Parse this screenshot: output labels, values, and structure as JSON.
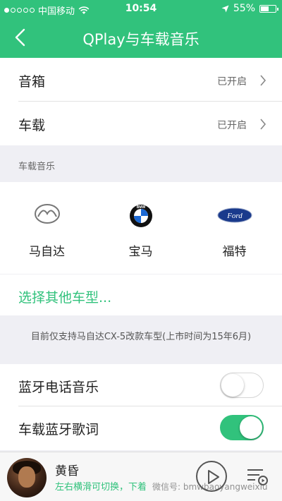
{
  "status_bar": {
    "carrier": "中国移动",
    "time": "10:54",
    "battery": "55%",
    "battery_level": 0.55,
    "signal_bars_filled": 1,
    "signal_bars_total": 5
  },
  "nav": {
    "title": "QPlay与车载音乐",
    "back_icon": "chevron-left-icon"
  },
  "settings": [
    {
      "label": "音箱",
      "value": "已开启"
    },
    {
      "label": "车载",
      "value": "已开启"
    }
  ],
  "car_music": {
    "section_title": "车载音乐",
    "brands": [
      {
        "label": "马自达",
        "icon": "mazda-logo-icon"
      },
      {
        "label": "宝马",
        "icon": "bmw-logo-icon"
      },
      {
        "label": "福特",
        "icon": "ford-logo-icon"
      }
    ],
    "bmw_logo_text": "BMW",
    "ford_logo_text": "Ford",
    "other_models_link": "选择其他车型..."
  },
  "support_note": "目前仅支持马自达CX-5改款车型(上市时间为15年6月)",
  "toggles": [
    {
      "label": "蓝牙电话音乐",
      "on": false
    },
    {
      "label": "车载蓝牙歌词",
      "on": true
    }
  ],
  "player": {
    "song_title": "黄昏",
    "hint": "左右横滑可切换，下着",
    "watermark": "微信号: bmwbaoyangweixiu",
    "play_icon": "play-icon",
    "queue_icon": "playlist-icon"
  },
  "colors": {
    "accent": "#31c27c",
    "background": "#efeff4"
  }
}
